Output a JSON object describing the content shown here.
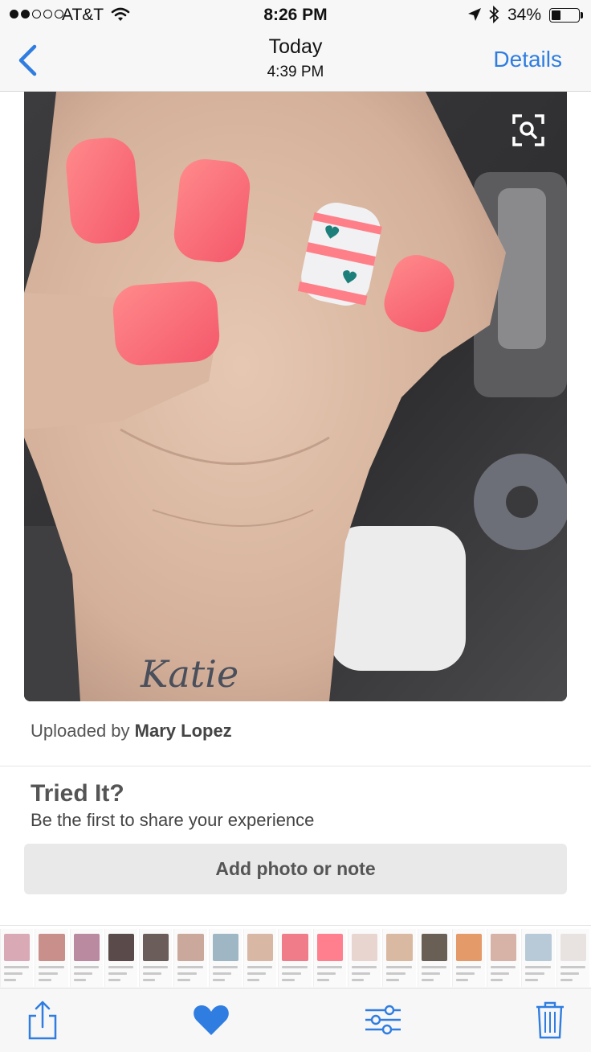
{
  "status_bar": {
    "carrier": "AT&T",
    "time": "8:26 PM",
    "battery_percent": "34%",
    "battery_level": 0.34,
    "signal_bars_filled": 2,
    "signal_bars_total": 5,
    "icons": [
      "wifi-icon",
      "location-arrow-icon",
      "bluetooth-icon",
      "battery-icon"
    ]
  },
  "nav": {
    "title": "Today",
    "subtitle": "4:39 PM",
    "details_label": "Details",
    "back_icon": "chevron-left-icon",
    "accent_color": "#2f7de1"
  },
  "photo": {
    "zoom_icon": "visual-search-icon",
    "tattoo_text": "Katie"
  },
  "uploader": {
    "prefix": "Uploaded by ",
    "name": "Mary Lopez"
  },
  "tried_it": {
    "title": "Tried It?",
    "subtitle": "Be the first to share your experience",
    "button_label": "Add photo or note"
  },
  "thumbnail_strip": {
    "thumbnails": [
      {
        "color": "#d9a9b6"
      },
      {
        "color": "#c98f8a"
      },
      {
        "color": "#b98aa0"
      },
      {
        "color": "#5a4a4a"
      },
      {
        "color": "#6b5e5a"
      },
      {
        "color": "#caa89c"
      },
      {
        "color": "#9fb6c4"
      },
      {
        "color": "#d8b7a5"
      },
      {
        "color": "#f07c8a"
      },
      {
        "color": "#ff7f8e"
      },
      {
        "color": "#e8d5d0"
      },
      {
        "color": "#d9b9a2"
      },
      {
        "color": "#6a5f55"
      },
      {
        "color": "#e59a6a"
      },
      {
        "color": "#d7b3a7"
      },
      {
        "color": "#b8cad8"
      },
      {
        "color": "#e8e2e0"
      }
    ]
  },
  "toolbar": {
    "share_icon": "share-icon",
    "like_icon": "heart-icon",
    "adjust_icon": "sliders-icon",
    "delete_icon": "trash-icon",
    "accent_color": "#2f7de1"
  }
}
